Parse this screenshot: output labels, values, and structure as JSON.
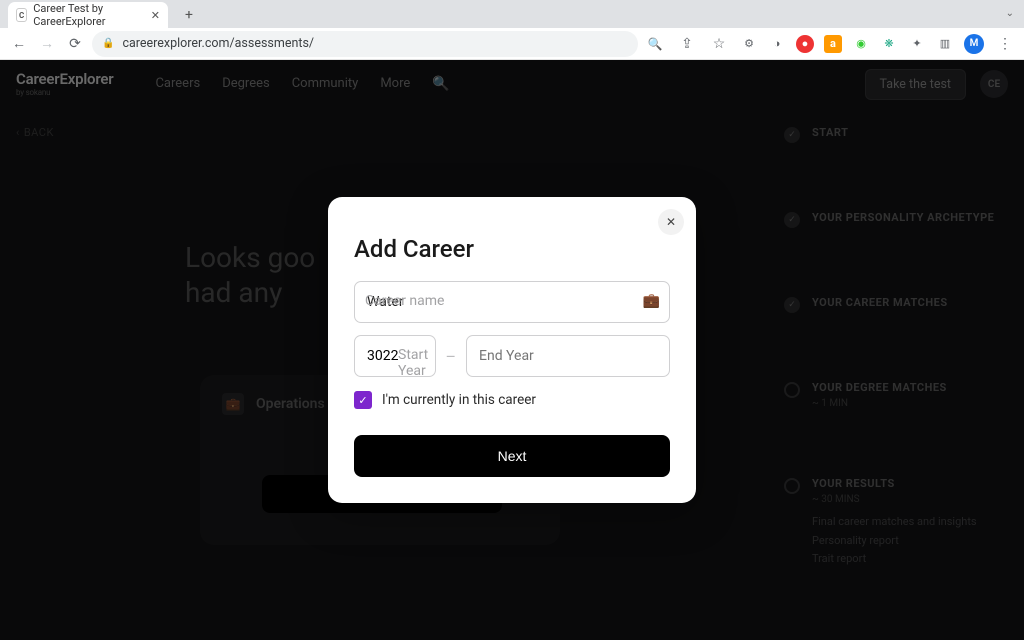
{
  "browser": {
    "tab_title": "Career Test by CareerExplorer",
    "favicon_text": "C",
    "url": "careerexplorer.com/assessments/"
  },
  "header": {
    "logo_main": "CareerExplorer",
    "logo_sub": "by sokanu",
    "nav": {
      "careers": "Careers",
      "degrees": "Degrees",
      "community": "Community",
      "more": "More"
    },
    "take_test": "Take the test",
    "avatar": "CE"
  },
  "page": {
    "back": "BACK",
    "hero_line1": "Looks goo",
    "hero_line2": "had any",
    "card_title": "Operations"
  },
  "steps": {
    "start": "START",
    "archetype": "YOUR PERSONALITY ARCHETYPE",
    "matches": "YOUR CAREER MATCHES",
    "degree": "YOUR DEGREE MATCHES",
    "degree_sub": "~ 1 MIN",
    "results": "YOUR RESULTS",
    "results_sub": "~ 30 MINS",
    "r1": "Final career matches and insights",
    "r2": "Personality report",
    "r3": "Trait report"
  },
  "modal": {
    "title": "Add Career",
    "career_value": "Water",
    "career_placeholder": "Career name",
    "start_value": "3022",
    "start_placeholder": "Start Year",
    "end_placeholder": "End Year",
    "checkbox_label": "I'm currently in this career",
    "checkbox_checked": true,
    "next": "Next"
  }
}
